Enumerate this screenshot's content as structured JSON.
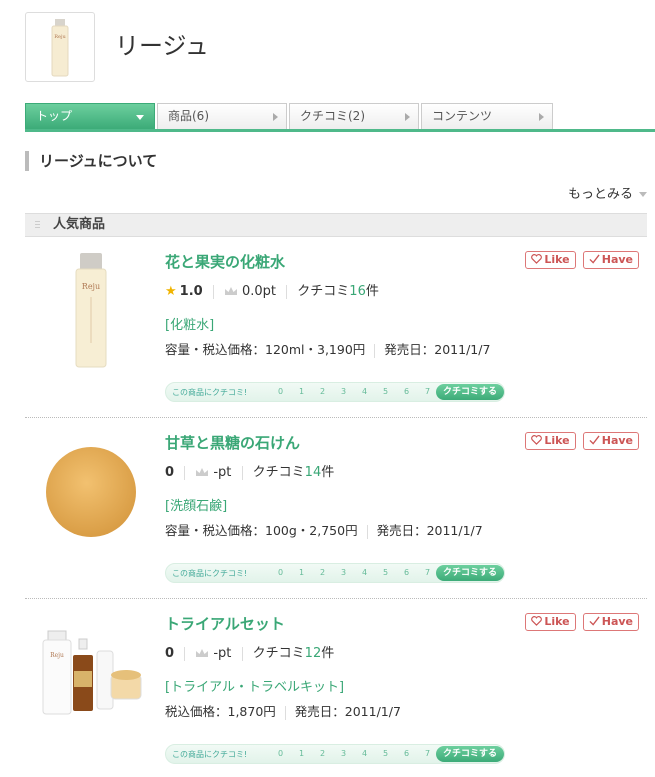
{
  "brand": {
    "name": "リージュ",
    "logo_text": "Reju"
  },
  "tabs": [
    {
      "label": "トップ",
      "active": true
    },
    {
      "label": "商品(6)",
      "active": false
    },
    {
      "label": "クチコミ(2)",
      "active": false
    },
    {
      "label": "コンテンツ",
      "active": false
    }
  ],
  "about": {
    "heading": "リージュについて",
    "more_label": "もっとみる"
  },
  "section": {
    "title": "人気商品"
  },
  "buttons": {
    "like": "Like",
    "have": "Have"
  },
  "review_bar": {
    "prompt": "この商品にクチコミ!",
    "scale": [
      "0",
      "1",
      "2",
      "3",
      "4",
      "5",
      "6",
      "7"
    ],
    "action": "クチコミする"
  },
  "products": [
    {
      "name": "花と果実の化粧水",
      "score": "1.0",
      "has_star": true,
      "points": "0.0pt",
      "review_label": "クチコミ",
      "review_count": "16",
      "review_suffix": "件",
      "category": "[化粧水]",
      "spec": "容量・税込価格：120ml・3,190円",
      "release": "発売日：2011/1/7"
    },
    {
      "name": "甘草と黒糖の石けん",
      "score": "0",
      "has_star": false,
      "points": "-pt",
      "review_label": "クチコミ",
      "review_count": "14",
      "review_suffix": "件",
      "category": "[洗顔石鹸]",
      "spec": "容量・税込価格：100g・2,750円",
      "release": "発売日：2011/1/7"
    },
    {
      "name": "トライアルセット",
      "score": "0",
      "has_star": false,
      "points": "-pt",
      "review_label": "クチコミ",
      "review_count": "12",
      "review_suffix": "件",
      "category": "[トライアル・トラベルキット]",
      "spec": "税込価格：1,870円",
      "release": "発売日：2011/1/7"
    }
  ],
  "colors": {
    "accent": "#3aa776",
    "tab_active": "#4fb98a",
    "like": "#cc5555",
    "star": "#f0b400"
  }
}
